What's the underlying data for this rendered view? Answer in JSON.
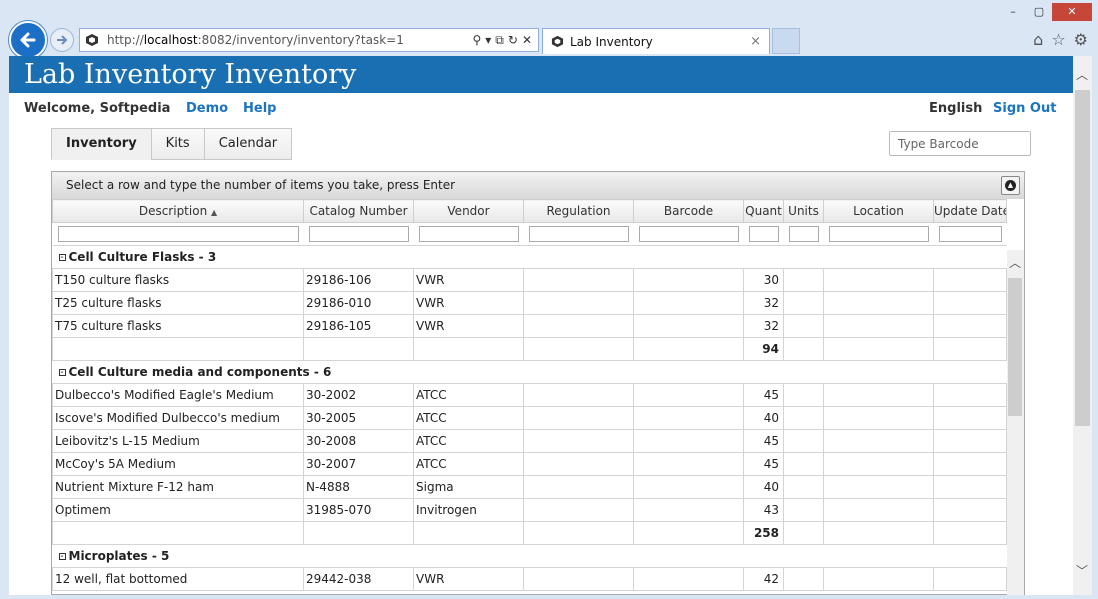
{
  "browser": {
    "url_prefix": "http://",
    "url_host": "localhost",
    "url_rest": ":8082/inventory/inventory?task=1",
    "tab_title": "Lab Inventory",
    "tab_close": "×",
    "win_min": "–",
    "win_max": "▢",
    "win_close": "✕"
  },
  "app": {
    "title": "Lab Inventory Inventory",
    "welcome": "Welcome, Softpedia",
    "demo": "Demo",
    "help": "Help",
    "language": "English",
    "sign_out": "Sign Out",
    "barcode_placeholder": "Type Barcode"
  },
  "tabs": [
    "Inventory",
    "Kits",
    "Calendar"
  ],
  "grid": {
    "hint": "Select a row and type the number of items you take, press Enter",
    "columns": [
      "Description",
      "Catalog Number",
      "Vendor",
      "Regulation",
      "Barcode",
      "Quant",
      "Units",
      "Location",
      "Update Date"
    ],
    "sort_indicator": "▲",
    "groups": [
      {
        "title": "Cell Culture Flasks - 3",
        "rows": [
          {
            "description": "T150 culture flasks",
            "catalog": "29186-106",
            "vendor": "VWR",
            "quant": "30"
          },
          {
            "description": "T25 culture flasks",
            "catalog": "29186-010",
            "vendor": "VWR",
            "quant": "32"
          },
          {
            "description": "T75 culture flasks",
            "catalog": "29186-105",
            "vendor": "VWR",
            "quant": "32"
          }
        ],
        "total": "94"
      },
      {
        "title": "Cell Culture media and components - 6",
        "rows": [
          {
            "description": "Dulbecco's Modified Eagle's Medium",
            "catalog": "30-2002",
            "vendor": "ATCC",
            "quant": "45"
          },
          {
            "description": "Iscove's Modified Dulbecco's medium",
            "catalog": "30-2005",
            "vendor": "ATCC",
            "quant": "40"
          },
          {
            "description": "Leibovitz's L-15 Medium",
            "catalog": "30-2008",
            "vendor": "ATCC",
            "quant": "45"
          },
          {
            "description": "McCoy's 5A Medium",
            "catalog": "30-2007",
            "vendor": "ATCC",
            "quant": "45"
          },
          {
            "description": "Nutrient Mixture F-12 ham",
            "catalog": "N-4888",
            "vendor": "Sigma",
            "quant": "40"
          },
          {
            "description": "Optimem",
            "catalog": "31985-070",
            "vendor": "Invitrogen",
            "quant": "43"
          }
        ],
        "total": "258"
      },
      {
        "title": "Microplates - 5",
        "rows": [
          {
            "description": "12 well, flat bottomed",
            "catalog": "29442-038",
            "vendor": "VWR",
            "quant": "42"
          }
        ],
        "total": ""
      }
    ]
  },
  "colors": {
    "banner": "#1a6eb2",
    "link": "#1a74c2"
  }
}
